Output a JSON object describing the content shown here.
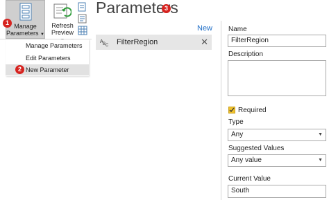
{
  "ribbon": {
    "manage_line1": "Manage",
    "manage_line2": "Parameters",
    "refresh_line1": "Refresh",
    "refresh_line2": "Preview"
  },
  "menu": {
    "items": [
      "Manage Parameters",
      "Edit Parameters",
      "New Parameter"
    ]
  },
  "callouts": [
    "1",
    "2",
    "3"
  ],
  "title": "Parameters",
  "list": {
    "new_link": "New",
    "items": [
      {
        "type_icon": "ABC",
        "label": "FilterRegion"
      }
    ],
    "remove_glyph": "✕"
  },
  "form": {
    "name_label": "Name",
    "name_value": "FilterRegion",
    "description_label": "Description",
    "description_value": "",
    "required_label": "Required",
    "required_checked": true,
    "type_label": "Type",
    "type_value": "Any",
    "suggested_label": "Suggested Values",
    "suggested_value": "Any value",
    "current_label": "Current Value",
    "current_value": "South"
  },
  "colors": {
    "accent_link": "#1f6ec7",
    "callout": "#d6231f",
    "checkbox": "#f0c12c",
    "selected_row": "#e6e6e6"
  }
}
